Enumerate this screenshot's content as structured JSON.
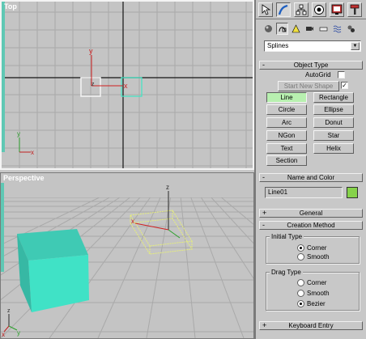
{
  "viewports": {
    "top": {
      "label": "Top"
    },
    "perspective": {
      "label": "Perspective"
    }
  },
  "command_panel": {
    "tabs": [
      "create",
      "modify",
      "hierarchy",
      "motion",
      "display",
      "utilities"
    ],
    "subcategories": [
      "geometry",
      "shapes",
      "lights",
      "cameras",
      "helpers",
      "space-warps",
      "systems"
    ],
    "category_select": {
      "value": "Splines"
    },
    "object_type": {
      "title": "Object Type",
      "autogrid_label": "AutoGrid",
      "start_new_shape_label": "Start New Shape",
      "start_new_shape_checked": true,
      "buttons": [
        "Line",
        "Rectangle",
        "Circle",
        "Ellipse",
        "Arc",
        "Donut",
        "NGon",
        "Star",
        "Text",
        "Helix",
        "Section"
      ],
      "active_button": "Line"
    },
    "name_and_color": {
      "title": "Name and Color",
      "name_value": "Line01",
      "color": "#86d24a"
    },
    "general": {
      "title": "General",
      "sign": "+"
    },
    "creation_method": {
      "title": "Creation Method",
      "sign": "-",
      "initial_type": {
        "title": "Initial Type",
        "options": [
          "Corner",
          "Smooth"
        ],
        "selected": "Corner"
      },
      "drag_type": {
        "title": "Drag Type",
        "options": [
          "Corner",
          "Smooth",
          "Bezier"
        ],
        "selected": "Bezier"
      }
    },
    "keyboard_entry": {
      "title": "Keyboard Entry",
      "sign": "+"
    }
  },
  "colors": {
    "viewport_bg": "#c4c4c4",
    "grid_line": "#a8a8a8",
    "axis_dark": "#141414",
    "selection_cyan": "#3fe6c4",
    "dashed_yellow": "#e6ee7a",
    "active_button_green": "#b8f0b0"
  }
}
